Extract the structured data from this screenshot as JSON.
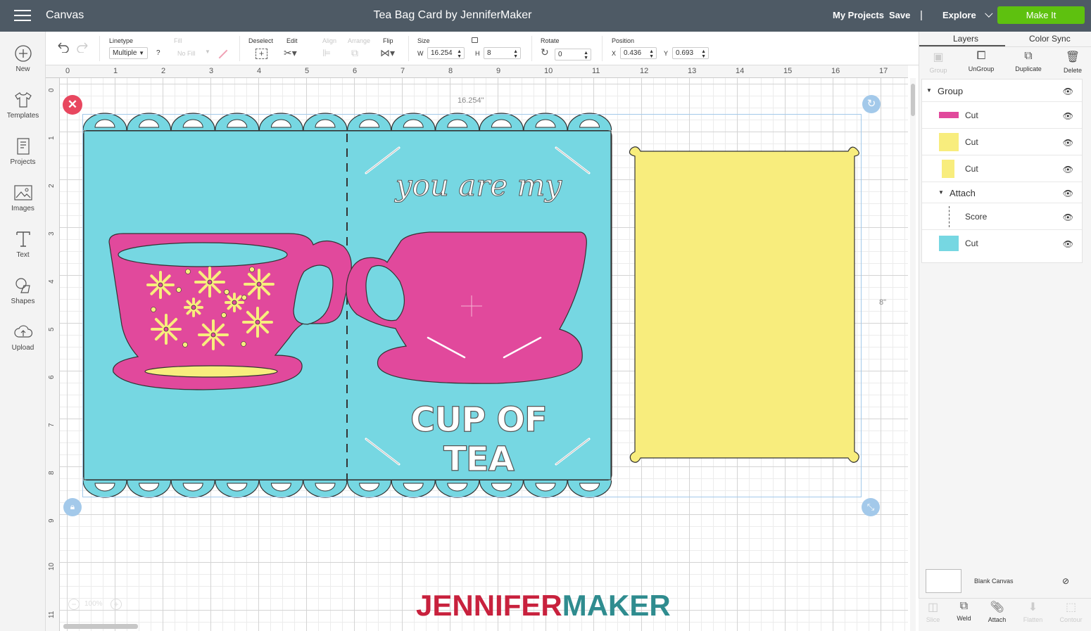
{
  "app": {
    "name": "Canvas",
    "project_title": "Tea Bag Card by JenniferMaker"
  },
  "topbar": {
    "my_projects": "My Projects",
    "save": "Save",
    "separator": "|",
    "machine": "Explore",
    "make_it": "Make It"
  },
  "sidebar": {
    "items": [
      {
        "label": "New",
        "icon": "plus-circle-icon"
      },
      {
        "label": "Templates",
        "icon": "tshirt-icon"
      },
      {
        "label": "Projects",
        "icon": "projects-icon"
      },
      {
        "label": "Images",
        "icon": "image-icon"
      },
      {
        "label": "Text",
        "icon": "text-icon"
      },
      {
        "label": "Shapes",
        "icon": "shapes-icon"
      },
      {
        "label": "Upload",
        "icon": "upload-icon"
      }
    ]
  },
  "toolbar": {
    "linetype_label": "Linetype",
    "linetype_value": "Multiple",
    "question": "?",
    "fill_label": "Fill",
    "fill_value": "No Fill",
    "deselect_label": "Deselect",
    "edit_label": "Edit",
    "align_label": "Align",
    "arrange_label": "Arrange",
    "flip_label": "Flip",
    "size_label": "Size",
    "w_label": "W",
    "w_value": "16.254",
    "h_label": "H",
    "h_value": "8",
    "rotate_label": "Rotate",
    "rotate_value": "0",
    "position_label": "Position",
    "x_label": "X",
    "x_value": "0.436",
    "y_label": "Y",
    "y_value": "0.693"
  },
  "ruler": {
    "top": [
      "0",
      "1",
      "2",
      "3",
      "4",
      "5",
      "6",
      "7",
      "8",
      "9",
      "10",
      "11",
      "12",
      "13",
      "14",
      "15",
      "16",
      "17"
    ],
    "left": [
      "0",
      "1",
      "2",
      "3",
      "4",
      "5",
      "6",
      "7",
      "8",
      "9",
      "10",
      "11"
    ]
  },
  "canvas": {
    "width_dim": "16.254\"",
    "height_dim": "8\"",
    "card_text_line1": "you are my",
    "card_text_line2": "CUP OF TEA",
    "zoom": "100%",
    "watermark": {
      "part1": "JENNIFER",
      "part2": "MAKER"
    },
    "colors": {
      "teal": "#76d7e2",
      "pink": "#e1499c",
      "yellow": "#f8ed7d",
      "selection": "#a3c9ea",
      "close": "#e8475f"
    }
  },
  "panel": {
    "tabs": [
      "Layers",
      "Color Sync"
    ],
    "actions": [
      {
        "label": "Group",
        "icon": "group-icon",
        "enabled": false
      },
      {
        "label": "UnGroup",
        "icon": "ungroup-icon",
        "enabled": true
      },
      {
        "label": "Duplicate",
        "icon": "duplicate-icon",
        "enabled": true
      },
      {
        "label": "Delete",
        "icon": "trash-icon",
        "enabled": true
      }
    ],
    "layers": [
      {
        "label": "Group",
        "type": "group"
      },
      {
        "label": "Cut",
        "type": "cut",
        "swatch": "#e1499c"
      },
      {
        "label": "Cut",
        "type": "cut",
        "swatch": "#f8ed7d"
      },
      {
        "label": "Cut",
        "type": "cut",
        "swatch": "#f8ed7d"
      },
      {
        "label": "Attach",
        "type": "attach"
      },
      {
        "label": "Score",
        "type": "score"
      },
      {
        "label": "Cut",
        "type": "cut",
        "swatch": "#76d7e2"
      }
    ],
    "blank_canvas": "Blank Canvas",
    "bottom_actions": [
      {
        "label": "Slice",
        "enabled": false
      },
      {
        "label": "Weld",
        "enabled": true
      },
      {
        "label": "Attach",
        "enabled": true
      },
      {
        "label": "Flatten",
        "enabled": false
      },
      {
        "label": "Contour",
        "enabled": false
      }
    ]
  }
}
